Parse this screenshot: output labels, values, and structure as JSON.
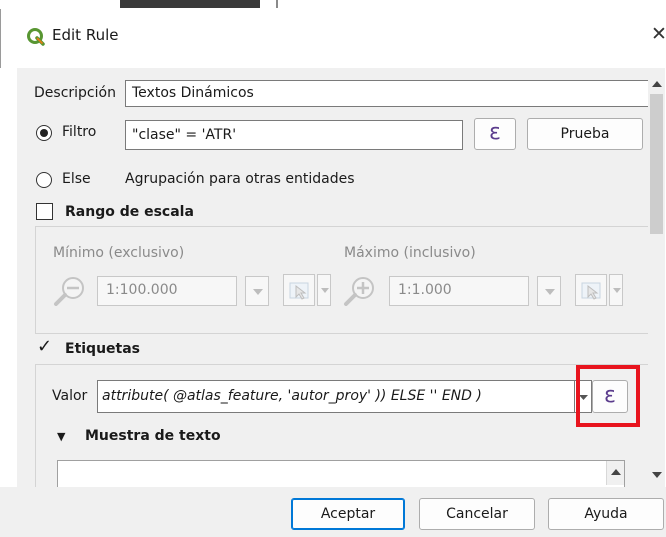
{
  "window": {
    "title": "Edit Rule",
    "close_glyph": "✕"
  },
  "descripcion": {
    "label": "Descripción",
    "value": "Textos Dinámicos"
  },
  "filtro": {
    "label": "Filtro",
    "value": "\"clase\"  =  'ATR'",
    "test_button": "Prueba",
    "selected": true
  },
  "else": {
    "label": "Else",
    "description": "Agrupación para otras entidades",
    "selected": false
  },
  "rango_escala": {
    "label": "Rango de escala",
    "checked": false,
    "min": {
      "label": "Mínimo (exclusivo)",
      "value": "1:100.000"
    },
    "max": {
      "label": "Máximo (inclusivo)",
      "value": "1:1.000"
    }
  },
  "etiquetas": {
    "label": "Etiquetas",
    "checked": true,
    "checkmark": "✓",
    "valor_label": "Valor",
    "valor_value": "attribute( @atlas_feature,  'autor_proy'  ))    ELSE  ''  END  )",
    "muestra_label": "Muestra de texto"
  },
  "icons": {
    "epsilon": "ε",
    "triangle_down": "▼",
    "arrow_up": "▲",
    "arrow_down": "▾"
  },
  "highlight_color": "#e8141e",
  "footer": {
    "ok": "Aceptar",
    "cancel": "Cancelar",
    "help": "Ayuda"
  }
}
